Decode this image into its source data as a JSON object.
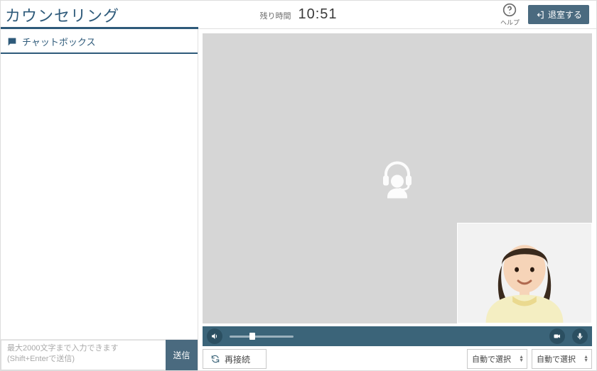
{
  "header": {
    "title": "カウンセリング",
    "timer_label": "残り時間",
    "timer_value": "10:51",
    "help_label": "ヘルプ",
    "leave_label": "退室する"
  },
  "chat": {
    "panel_title": "チャットボックス",
    "input_placeholder": "最大2000文字まで入力できます\n(Shift+Enterで送信)",
    "send_label": "送信"
  },
  "video": {
    "volume_percent": 35,
    "reconnect_label": "再接続",
    "camera_select": "自動で選択",
    "mic_select": "自動で選択"
  }
}
